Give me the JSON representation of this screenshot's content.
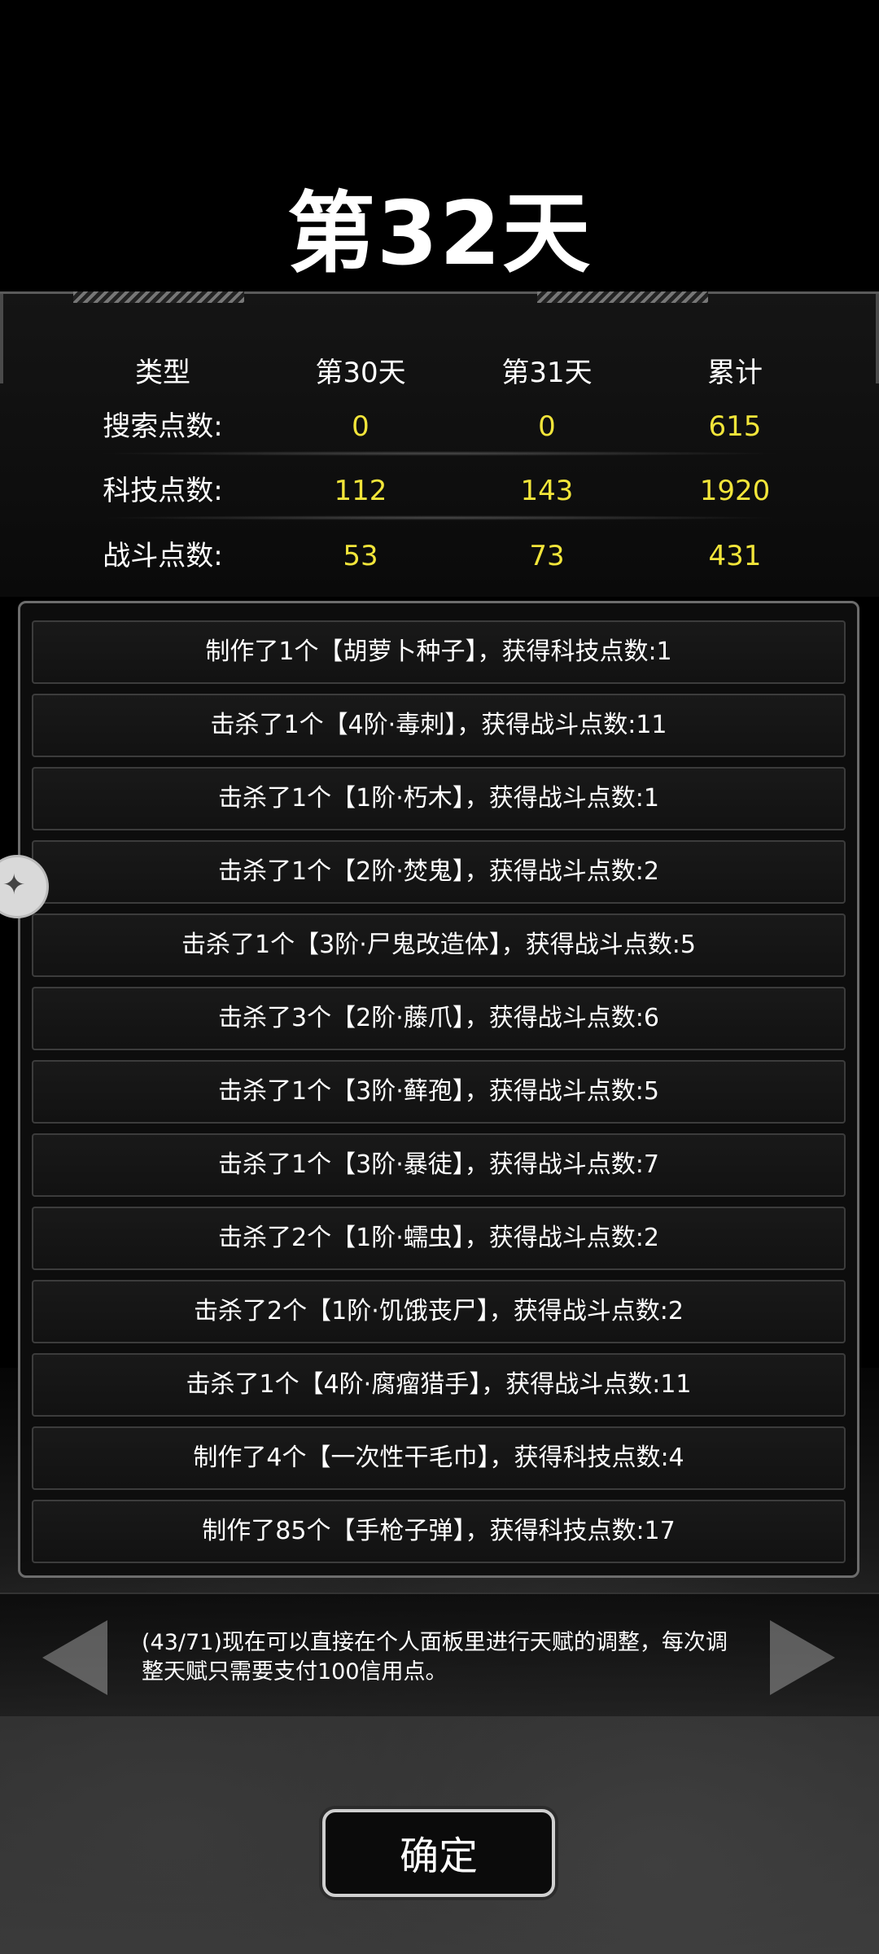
{
  "title": "第32天",
  "stats": {
    "headers": [
      "类型",
      "第30天",
      "第31天",
      "累计"
    ],
    "rows": [
      {
        "label": "搜索点数:",
        "day30": "0",
        "day31": "0",
        "total": "615"
      },
      {
        "label": "科技点数:",
        "day30": "112",
        "day31": "143",
        "total": "1920"
      },
      {
        "label": "战斗点数:",
        "day30": "53",
        "day31": "73",
        "total": "431"
      }
    ]
  },
  "log": [
    "制作了1个【胡萝卜种子】，获得科技点数:1",
    "击杀了1个【4阶·毒刺】，获得战斗点数:11",
    "击杀了1个【1阶·朽木】，获得战斗点数:1",
    "击杀了1个【2阶·焚鬼】，获得战斗点数:2",
    "击杀了1个【3阶·尸鬼改造体】，获得战斗点数:5",
    "击杀了3个【2阶·藤爪】，获得战斗点数:6",
    "击杀了1个【3阶·藓孢】，获得战斗点数:5",
    "击杀了1个【3阶·暴徒】，获得战斗点数:7",
    "击杀了2个【1阶·蠕虫】，获得战斗点数:2",
    "击杀了2个【1阶·饥饿丧尸】，获得战斗点数:2",
    "击杀了1个【4阶·腐瘤猎手】，获得战斗点数:11",
    "制作了4个【一次性干毛巾】，获得科技点数:4",
    "制作了85个【手枪子弹】，获得科技点数:17"
  ],
  "tip": {
    "text": "(43/71)现在可以直接在个人面板里进行天赋的调整，每次调整天赋只需要支付100信用点。"
  },
  "confirm_label": "确定",
  "colors": {
    "value": "#f2e53a",
    "background": "#000000"
  }
}
